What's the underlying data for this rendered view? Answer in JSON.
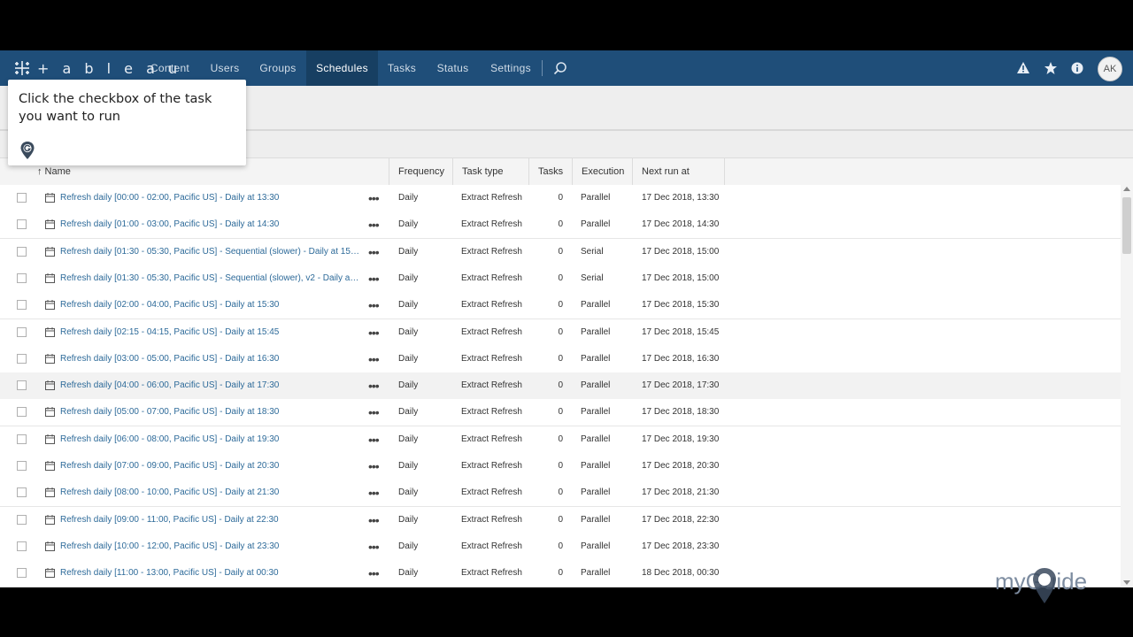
{
  "app": {
    "logo_text": "+ a b l e a u"
  },
  "nav": {
    "items": [
      {
        "label": "Content"
      },
      {
        "label": "Users"
      },
      {
        "label": "Groups"
      },
      {
        "label": "Schedules"
      },
      {
        "label": "Tasks"
      },
      {
        "label": "Status"
      },
      {
        "label": "Settings"
      }
    ],
    "active": "Schedules",
    "icons": [
      "search-icon",
      "alert-icon",
      "star-icon",
      "info-icon"
    ],
    "avatar": "AK"
  },
  "guide": {
    "text": "Click the checkbox of the task you want to run"
  },
  "table": {
    "columns": [
      "↑ Name",
      "Frequency",
      "Task type",
      "Tasks",
      "Execution",
      "Next run at"
    ],
    "rows": [
      {
        "name": "Refresh daily [00:00 - 02:00, Pacific US] - Daily at 13:30",
        "frequency": "Daily",
        "task_type": "Extract Refresh",
        "tasks": "0",
        "execution": "Parallel",
        "next_run": "17 Dec 2018, 13:30"
      },
      {
        "name": "Refresh daily [01:00 - 03:00, Pacific US] - Daily at 14:30",
        "frequency": "Daily",
        "task_type": "Extract Refresh",
        "tasks": "0",
        "execution": "Parallel",
        "next_run": "17 Dec 2018, 14:30"
      },
      {
        "name": "Refresh daily [01:30 - 05:30, Pacific US] - Sequential (slower) - Daily at 15:00",
        "frequency": "Daily",
        "task_type": "Extract Refresh",
        "tasks": "0",
        "execution": "Serial",
        "next_run": "17 Dec 2018, 15:00"
      },
      {
        "name": "Refresh daily [01:30 - 05:30, Pacific US] - Sequential (slower), v2 - Daily at 1...",
        "frequency": "Daily",
        "task_type": "Extract Refresh",
        "tasks": "0",
        "execution": "Serial",
        "next_run": "17 Dec 2018, 15:00"
      },
      {
        "name": "Refresh daily [02:00 - 04:00, Pacific US] - Daily at 15:30",
        "frequency": "Daily",
        "task_type": "Extract Refresh",
        "tasks": "0",
        "execution": "Parallel",
        "next_run": "17 Dec 2018, 15:30"
      },
      {
        "name": "Refresh daily [02:15 - 04:15, Pacific US] - Daily at 15:45",
        "frequency": "Daily",
        "task_type": "Extract Refresh",
        "tasks": "0",
        "execution": "Parallel",
        "next_run": "17 Dec 2018, 15:45"
      },
      {
        "name": "Refresh daily [03:00 - 05:00, Pacific US] - Daily at 16:30",
        "frequency": "Daily",
        "task_type": "Extract Refresh",
        "tasks": "0",
        "execution": "Parallel",
        "next_run": "17 Dec 2018, 16:30"
      },
      {
        "name": "Refresh daily [04:00 - 06:00, Pacific US] - Daily at 17:30",
        "frequency": "Daily",
        "task_type": "Extract Refresh",
        "tasks": "0",
        "execution": "Parallel",
        "next_run": "17 Dec 2018, 17:30",
        "highlighted": true
      },
      {
        "name": "Refresh daily [05:00 - 07:00, Pacific US] - Daily at 18:30",
        "frequency": "Daily",
        "task_type": "Extract Refresh",
        "tasks": "0",
        "execution": "Parallel",
        "next_run": "17 Dec 2018, 18:30"
      },
      {
        "name": "Refresh daily [06:00 - 08:00, Pacific US] - Daily at 19:30",
        "frequency": "Daily",
        "task_type": "Extract Refresh",
        "tasks": "0",
        "execution": "Parallel",
        "next_run": "17 Dec 2018, 19:30"
      },
      {
        "name": "Refresh daily [07:00 - 09:00, Pacific US] - Daily at 20:30",
        "frequency": "Daily",
        "task_type": "Extract Refresh",
        "tasks": "0",
        "execution": "Parallel",
        "next_run": "17 Dec 2018, 20:30"
      },
      {
        "name": "Refresh daily [08:00 - 10:00, Pacific US] - Daily at 21:30",
        "frequency": "Daily",
        "task_type": "Extract Refresh",
        "tasks": "0",
        "execution": "Parallel",
        "next_run": "17 Dec 2018, 21:30"
      },
      {
        "name": "Refresh daily [09:00 - 11:00, Pacific US] - Daily at 22:30",
        "frequency": "Daily",
        "task_type": "Extract Refresh",
        "tasks": "0",
        "execution": "Parallel",
        "next_run": "17 Dec 2018, 22:30"
      },
      {
        "name": "Refresh daily [10:00 - 12:00, Pacific US] - Daily at 23:30",
        "frequency": "Daily",
        "task_type": "Extract Refresh",
        "tasks": "0",
        "execution": "Parallel",
        "next_run": "17 Dec 2018, 23:30"
      },
      {
        "name": "Refresh daily [11:00 - 13:00, Pacific US] - Daily at 00:30",
        "frequency": "Daily",
        "task_type": "Extract Refresh",
        "tasks": "0",
        "execution": "Parallel",
        "next_run": "18 Dec 2018, 00:30"
      }
    ],
    "row_actions_label": "•••"
  },
  "watermark": {
    "text": "myGuide"
  },
  "colors": {
    "nav_bg": "#1f4e79",
    "nav_active": "#173f62",
    "link": "#2d6a99"
  }
}
